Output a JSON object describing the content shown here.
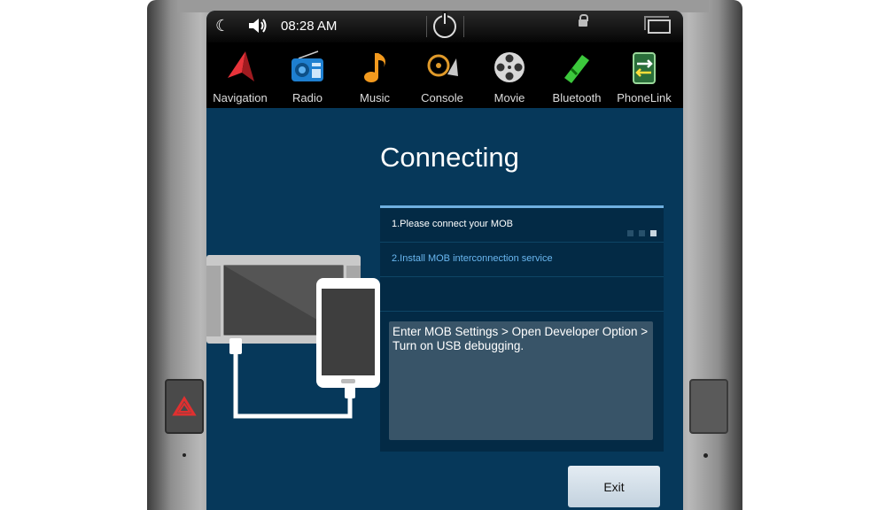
{
  "status_bar": {
    "time": "08:28 AM",
    "icons": [
      "moon-icon",
      "volume-icon",
      "power-icon",
      "lock-icon",
      "window-icon"
    ]
  },
  "apps": [
    {
      "label": "Navigation",
      "icon": "navigation-icon"
    },
    {
      "label": "Radio",
      "icon": "radio-icon"
    },
    {
      "label": "Music",
      "icon": "music-icon"
    },
    {
      "label": "Console",
      "icon": "console-icon"
    },
    {
      "label": "Movie",
      "icon": "movie-icon"
    },
    {
      "label": "Bluetooth",
      "icon": "bluetooth-icon"
    },
    {
      "label": "PhoneLink",
      "icon": "phonelink-icon"
    }
  ],
  "main": {
    "title": "Connecting",
    "steps": [
      "1.Please connect your MOB",
      "2.Install MOB interconnection service"
    ],
    "instruction": "Enter MOB Settings > Open Developer Option > Turn on USB debugging.",
    "exit_label": "Exit"
  },
  "colors": {
    "background": "#06385a",
    "panel": "#032a45",
    "accent_blue": "#6ab7f0",
    "instruction_box": "#385468"
  }
}
